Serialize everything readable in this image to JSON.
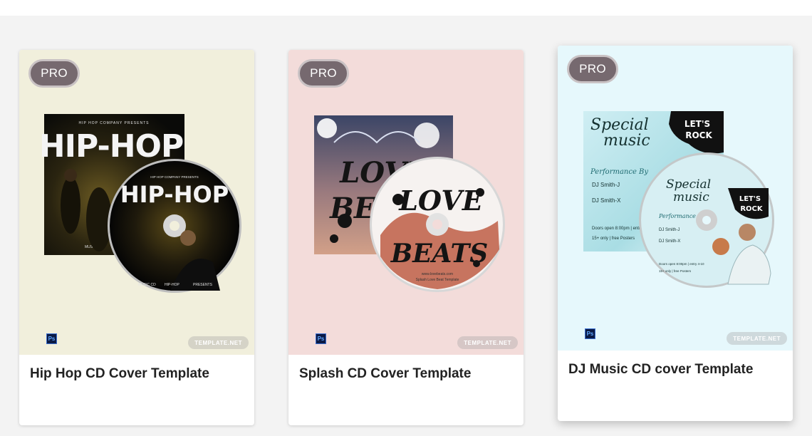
{
  "badge_label": "PRO",
  "ps_label": "Ps",
  "watermark": "TEMPLATE.NET",
  "cards": [
    {
      "title": "Hip Hop CD Cover Template",
      "thumb_bg": "#f1efdc",
      "cover_lines": [
        "HIP HOP COMPANY PRESENTS",
        "HIP-HOP",
        "MUSIC CD"
      ],
      "disc_lines": [
        "HIP HOP COMPANY PRESENTS",
        "HIP-HOP",
        "MUSIC CD",
        "HIP-HOP",
        "PRESENTS"
      ]
    },
    {
      "title": "Splash CD Cover Template",
      "thumb_bg": "#f3dcda",
      "cover_lines": [
        "LOVE",
        "BEATS"
      ],
      "disc_lines": [
        "LOVE",
        "BEATS",
        "www.lovebeats.com",
        "Splash Love Beat Template"
      ]
    },
    {
      "title": "DJ Music CD cover Template",
      "thumb_bg": "#e6f8fc",
      "cover_lines": [
        "Special",
        "music",
        "LET'S",
        "ROCK",
        "Performance By",
        "DJ Smith-J",
        "DJ Smith-X",
        "Doors open 8:00pm | entry 4-10",
        "15+ only | free Posters"
      ],
      "disc_lines": [
        "Special",
        "music",
        "LET'S",
        "ROCK",
        "Performance B",
        "DJ Smith-J",
        "DJ Smith-X",
        "Doors open 8:00pm | entry 4-10",
        "15+ only | free Posters"
      ]
    }
  ]
}
